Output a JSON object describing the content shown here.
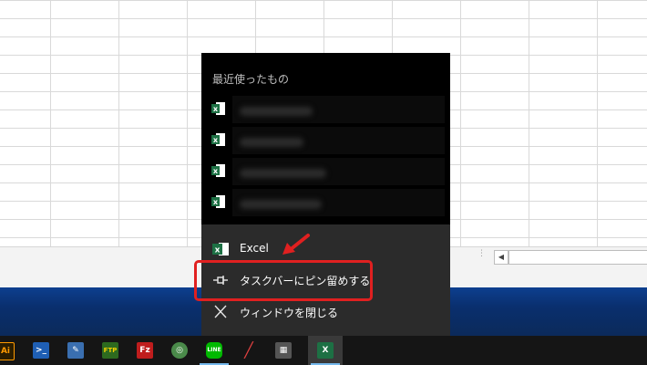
{
  "jumplist": {
    "recent_heading": "最近使ったもの",
    "recent_items_count_visible": 4,
    "app_name": "Excel",
    "pin_label": "タスクバーにピン留めする",
    "close_label": "ウィンドウを閉じる",
    "app_icon": "excel-icon",
    "pin_icon": "pin-icon",
    "close_icon": "close-icon"
  },
  "taskbar": {
    "items": [
      {
        "name": "illustrator",
        "glyph": "Ai",
        "color": "#ff9a00",
        "bg": "#2b1d00"
      },
      {
        "name": "powershell",
        "glyph": ">",
        "color": "#ffffff",
        "bg": "#1f5fb4"
      },
      {
        "name": "paint-tool",
        "glyph": "✎",
        "color": "#ffffff",
        "bg": "#3a6fb0"
      },
      {
        "name": "ffftp",
        "glyph": "FTP",
        "color": "#f0d000",
        "bg": "#2d6a1f"
      },
      {
        "name": "filezilla",
        "glyph": "Fz",
        "color": "#ffffff",
        "bg": "#bf1d1d"
      },
      {
        "name": "chrome-like",
        "glyph": "◎",
        "color": "#ffffff",
        "bg": "#4a8a4a"
      },
      {
        "name": "line",
        "glyph": "LINE",
        "color": "#ffffff",
        "bg": "#00b900"
      },
      {
        "name": "pen-tool",
        "glyph": "╱",
        "color": "#e04040",
        "bg": "#151515"
      },
      {
        "name": "calculator",
        "glyph": "▦",
        "color": "#ffffff",
        "bg": "#555555"
      },
      {
        "name": "excel",
        "glyph": "X",
        "color": "#ffffff",
        "bg": "#1d7044"
      }
    ],
    "active": "excel"
  },
  "colors": {
    "jumplist_bg": "#2b2b2b",
    "recent_bg": "#000000",
    "highlight": "#e02020",
    "excel_green": "#1d7044"
  }
}
